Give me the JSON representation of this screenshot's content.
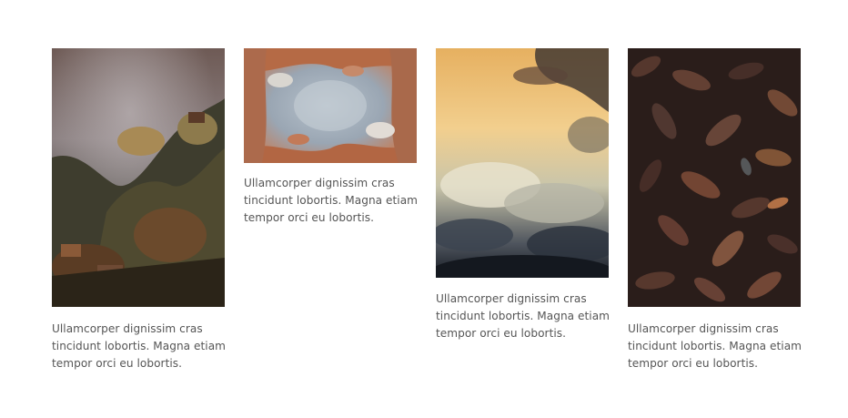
{
  "gallery": {
    "items": [
      {
        "image_subject": "misty forested hillside with houses",
        "caption": "Ullamcorper dignissim cras tincidunt lobortis. Magna etiam tempor orci eu lobortis."
      },
      {
        "image_subject": "baroque ceiling fresco with sky and clouds",
        "caption": "Ullamcorper dignissim cras tincidunt lobortis. Magna etiam tempor orci eu lobortis."
      },
      {
        "image_subject": "sunlit dramatic clouds",
        "caption": "Ullamcorper dignissim cras tincidunt lobortis. Magna etiam tempor orci eu lobortis."
      },
      {
        "image_subject": "dark autumn leaves on ground",
        "caption": "Ullamcorper dignissim cras tincidunt lobortis. Magna etiam tempor orci eu lobortis."
      }
    ]
  },
  "colors": {
    "caption_text": "#555555",
    "background": "#ffffff"
  }
}
